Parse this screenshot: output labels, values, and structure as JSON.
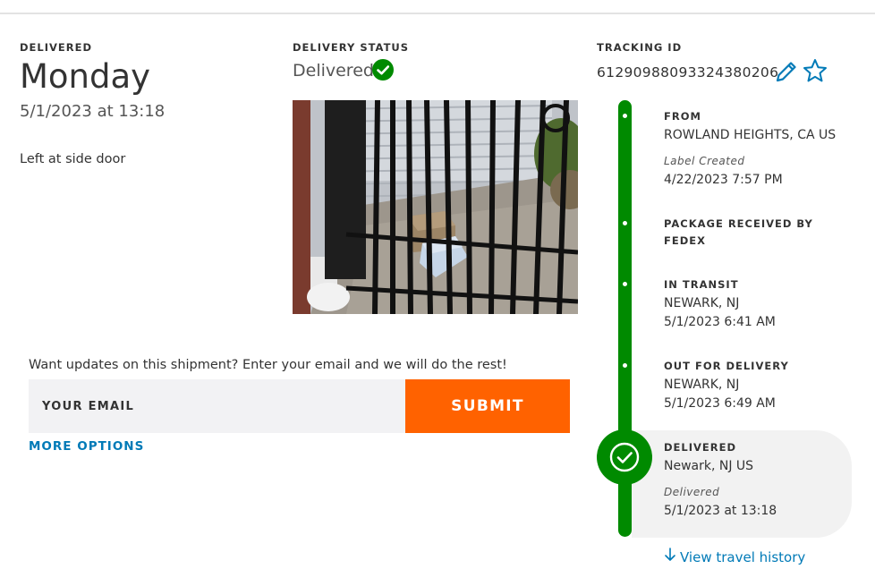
{
  "summary": {
    "delivered_label": "DELIVERED",
    "day": "Monday",
    "datetime": "5/1/2023 at 13:18",
    "note": "Left at side door"
  },
  "status": {
    "label": "DELIVERY STATUS",
    "value": "Delivered",
    "icon": "check-circle-icon",
    "color": "#008a00"
  },
  "tracking": {
    "label": "TRACKING ID",
    "id": "61290988093324380206",
    "edit_icon": "pencil-icon",
    "watch_icon": "star-icon"
  },
  "updates": {
    "prompt": "Want updates on this shipment? Enter your email and we will do the rest!",
    "email_placeholder": "YOUR EMAIL",
    "submit_label": "SUBMIT",
    "more_options": "MORE OPTIONS"
  },
  "timeline": {
    "from": {
      "title": "FROM",
      "location": "ROWLAND HEIGHTS, CA US",
      "sub_label": "Label Created",
      "datetime": "4/22/2023 7:57 PM"
    },
    "received": {
      "title_line1": "PACKAGE RECEIVED BY",
      "title_line2": "FEDEX"
    },
    "in_transit": {
      "title": "IN TRANSIT",
      "location": "NEWARK, NJ",
      "datetime": "5/1/2023 6:41 AM"
    },
    "out_for_delivery": {
      "title": "OUT FOR DELIVERY",
      "location": "NEWARK, NJ",
      "datetime": "5/1/2023 6:49 AM"
    },
    "delivered": {
      "title": "DELIVERED",
      "location": "Newark, NJ US",
      "sub_label": "Delivered",
      "datetime": "5/1/2023 at 13:18"
    },
    "history_link": "View travel history"
  },
  "colors": {
    "accent_green": "#008a00",
    "submit_orange": "#ff6200",
    "link_blue": "#007ab7"
  }
}
